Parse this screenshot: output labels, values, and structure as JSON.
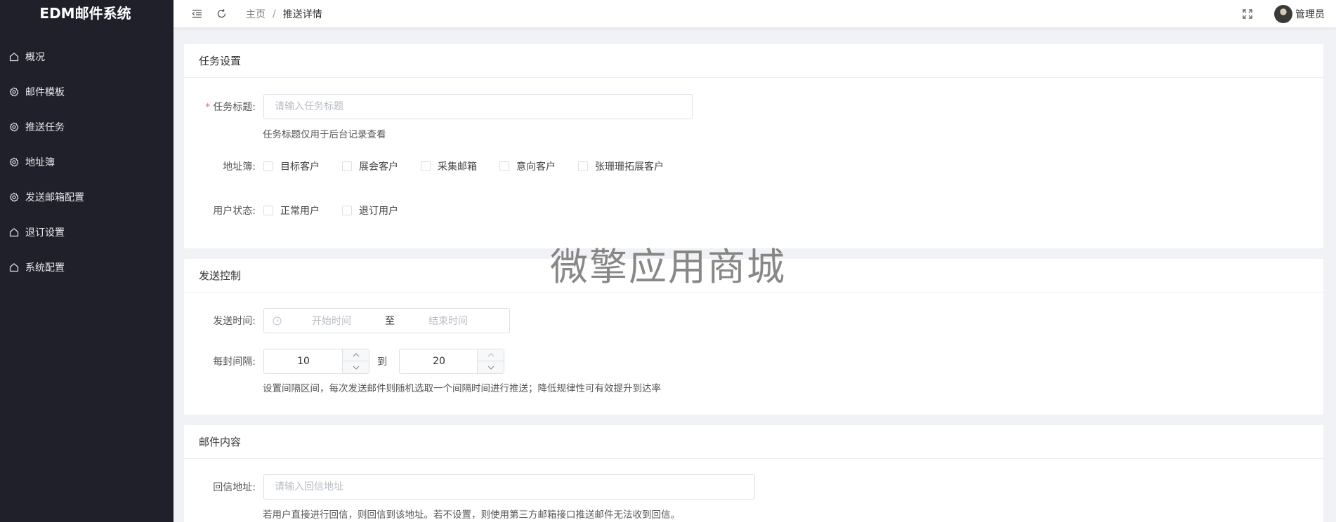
{
  "app": {
    "title": "EDM邮件系统"
  },
  "sidebar": {
    "items": [
      {
        "label": "概况",
        "icon": "home-icon"
      },
      {
        "label": "邮件模板",
        "icon": "gear-icon"
      },
      {
        "label": "推送任务",
        "icon": "gear-icon"
      },
      {
        "label": "地址簿",
        "icon": "gear-icon"
      },
      {
        "label": "发送邮箱配置",
        "icon": "gear-icon"
      },
      {
        "label": "退订设置",
        "icon": "home-icon"
      },
      {
        "label": "系统配置",
        "icon": "home-icon"
      }
    ]
  },
  "header": {
    "breadcrumb": {
      "home": "主页",
      "separator": "/",
      "current": "推送详情"
    },
    "user": {
      "name": "管理员"
    }
  },
  "task": {
    "section_title": "任务设置",
    "title_label": "任务标题:",
    "title_required_mark": "*",
    "title_placeholder": "请输入任务标题",
    "title_value": "",
    "title_hint": "任务标题仅用于后台记录查看",
    "address_label": "地址簿:",
    "address_options": [
      "目标客户",
      "展会客户",
      "采集邮箱",
      "意向客户",
      "张珊珊拓展客户"
    ],
    "status_label": "用户状态:",
    "status_options": [
      "正常用户",
      "退订用户"
    ]
  },
  "send": {
    "section_title": "发送控制",
    "time_label": "发送时间:",
    "start_placeholder": "开始时间",
    "range_separator": "至",
    "end_placeholder": "结束时间",
    "interval_label": "每封间隔:",
    "interval_min": "10",
    "interval_separator": "到",
    "interval_max": "20",
    "interval_hint": "设置间隔区间，每次发送邮件则随机选取一个间隔时间进行推送；降低规律性可有效提升到达率"
  },
  "mail": {
    "section_title": "邮件内容",
    "reply_label": "回信地址:",
    "reply_placeholder": "请输入回信地址",
    "reply_value": "",
    "reply_hint": "若用户直接进行回信，则回信到该地址。若不设置，则使用第三方邮箱接口推送邮件无法收到回信。"
  },
  "watermark": "微擎应用商城",
  "colors": {
    "sidebar_bg": "#1f2029",
    "required": "#f56c6c",
    "page_bg": "#f0f2f5"
  }
}
